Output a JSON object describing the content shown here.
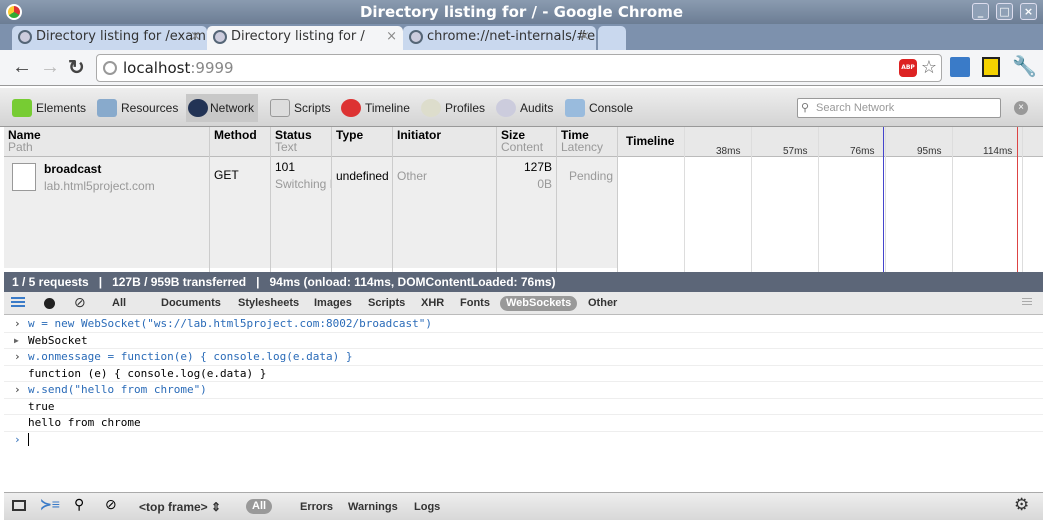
{
  "window": {
    "title": "Directory listing for / - Google Chrome"
  },
  "tabs": [
    {
      "label": "Directory listing for /exam"
    },
    {
      "label": "Directory listing for /"
    },
    {
      "label": "chrome://net-internals/#e"
    }
  ],
  "omnibox": {
    "host": "localhost",
    "port": ":9999"
  },
  "extensions": {
    "abp": "ABP"
  },
  "devtools": {
    "panels": [
      "Elements",
      "Resources",
      "Network",
      "Scripts",
      "Timeline",
      "Profiles",
      "Audits",
      "Console"
    ],
    "active_panel": "Network",
    "search_placeholder": "Search Network"
  },
  "network": {
    "columns": [
      {
        "title": "Name",
        "sub": "Path"
      },
      {
        "title": "Method",
        "sub": ""
      },
      {
        "title": "Status",
        "sub": "Text"
      },
      {
        "title": "Type",
        "sub": ""
      },
      {
        "title": "Initiator",
        "sub": ""
      },
      {
        "title": "Size",
        "sub": "Content"
      },
      {
        "title": "Time",
        "sub": "Latency"
      },
      {
        "title": "Timeline",
        "sub": ""
      }
    ],
    "timeline_ticks": [
      "38ms",
      "57ms",
      "76ms",
      "95ms",
      "114ms"
    ],
    "rows": [
      {
        "name": "broadcast",
        "path": "lab.html5project.com",
        "method": "GET",
        "status": "101",
        "status_text": "Switching P",
        "type": "undefined",
        "initiator": "Other",
        "size": "127B",
        "content": "0B",
        "time": "Pending"
      }
    ],
    "summary": "1 / 5 requests   |   127B / 959B transferred   |   94ms (onload: 114ms, DOMContentLoaded: 76ms)",
    "filters": [
      "All",
      "Documents",
      "Stylesheets",
      "Images",
      "Scripts",
      "XHR",
      "Fonts",
      "WebSockets",
      "Other"
    ],
    "active_filter": "WebSockets"
  },
  "console": {
    "lines": [
      {
        "kind": "cmd",
        "text": "w = new WebSocket(\"ws://lab.html5project.com:8002/broadcast\")"
      },
      {
        "kind": "obj",
        "text": "WebSocket"
      },
      {
        "kind": "cmd",
        "text": "w.onmessage = function(e) { console.log(e.data) }"
      },
      {
        "kind": "out",
        "text": "function (e) { console.log(e.data) }"
      },
      {
        "kind": "cmd",
        "text": "w.send(\"hello from chrome\")"
      },
      {
        "kind": "out",
        "text": "true"
      },
      {
        "kind": "out",
        "text": "hello from chrome"
      }
    ]
  },
  "bottom": {
    "frame": "<top frame>",
    "levels": [
      "All",
      "Errors",
      "Warnings",
      "Logs"
    ]
  }
}
